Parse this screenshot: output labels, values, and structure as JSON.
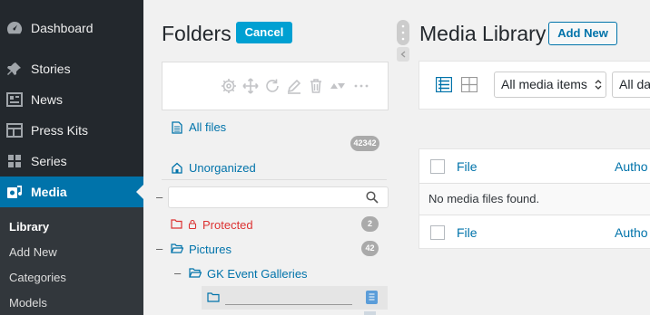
{
  "sidebar": {
    "items": [
      {
        "label": "Dashboard",
        "icon": "dashboard-icon"
      },
      {
        "label": "Stories",
        "icon": "pin-icon"
      },
      {
        "label": "News",
        "icon": "news-icon"
      },
      {
        "label": "Press Kits",
        "icon": "presskit-icon"
      },
      {
        "label": "Series",
        "icon": "grid-icon"
      },
      {
        "label": "Media",
        "icon": "media-icon"
      }
    ],
    "submenu": [
      "Library",
      "Add New",
      "Categories",
      "Models"
    ]
  },
  "folders": {
    "title": "Folders",
    "cancel_label": "Cancel",
    "toolbar_icons": [
      "gear-icon",
      "move-icon",
      "refresh-icon",
      "edit-icon",
      "trash-icon",
      "sort-icon",
      "more-icon"
    ],
    "all_files": {
      "label": "All files",
      "count": "42342"
    },
    "unorganized": {
      "label": "Unorganized"
    },
    "collapse_symbol": "–",
    "search": {
      "placeholder": ""
    },
    "protected": {
      "label": "Protected",
      "count": "2"
    },
    "pictures": {
      "label": "Pictures",
      "count": "42"
    },
    "gk_event": {
      "label": "GK Event Galleries"
    }
  },
  "media": {
    "title": "Media Library",
    "add_new_label": "Add New",
    "filter_select": "All media items",
    "date_select": "All da",
    "columns": {
      "file": "File",
      "author": "Autho"
    },
    "empty_message": "No media files found."
  },
  "colors": {
    "accent": "#0073aa",
    "sidebar": "#23282d",
    "button": "#00a0d2",
    "protected": "#dc3232"
  }
}
